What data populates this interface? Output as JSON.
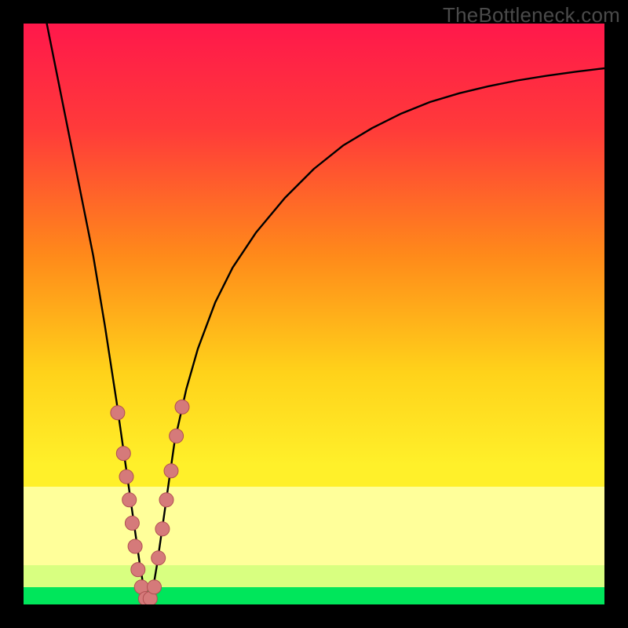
{
  "watermark": "TheBottleneck.com",
  "colors": {
    "frame": "#000000",
    "gradient_top": "#ff1a4b",
    "gradient_mid_upper": "#ff6a1f",
    "gradient_mid": "#ffe626",
    "gradient_mid_lower": "#f8ff66",
    "gradient_green": "#00e65b",
    "curve": "#000000",
    "marker_fill": "#d57a7a",
    "marker_stroke": "#b04f52",
    "pale_band": "#ffffa8"
  },
  "chart_data": {
    "type": "line",
    "title": "",
    "xlabel": "",
    "ylabel": "",
    "xlim": [
      0,
      100
    ],
    "ylim": [
      0,
      100
    ],
    "grid": false,
    "legend": false,
    "minimum_x": 21,
    "series": [
      {
        "name": "bottleneck-curve",
        "x": [
          4,
          6,
          8,
          10,
          12,
          14,
          16,
          17,
          18,
          19,
          20,
          21,
          22,
          23,
          24,
          25,
          26,
          28,
          30,
          33,
          36,
          40,
          45,
          50,
          55,
          60,
          65,
          70,
          75,
          80,
          85,
          90,
          95,
          100
        ],
        "y": [
          100,
          90,
          80,
          70,
          60,
          48,
          35,
          28,
          21,
          14,
          7,
          1,
          1,
          7,
          14,
          21,
          28,
          37,
          44,
          52,
          58,
          64,
          70,
          75,
          79,
          82,
          84.5,
          86.5,
          88,
          89.2,
          90.2,
          91,
          91.7,
          92.3
        ]
      }
    ],
    "markers": {
      "name": "highlighted-points",
      "points": [
        {
          "x": 16.2,
          "y": 33
        },
        {
          "x": 17.2,
          "y": 26
        },
        {
          "x": 17.7,
          "y": 22
        },
        {
          "x": 18.2,
          "y": 18
        },
        {
          "x": 18.7,
          "y": 14
        },
        {
          "x": 19.2,
          "y": 10
        },
        {
          "x": 19.7,
          "y": 6
        },
        {
          "x": 20.3,
          "y": 3
        },
        {
          "x": 21.0,
          "y": 1
        },
        {
          "x": 21.8,
          "y": 1
        },
        {
          "x": 22.5,
          "y": 3
        },
        {
          "x": 23.2,
          "y": 8
        },
        {
          "x": 23.9,
          "y": 13
        },
        {
          "x": 24.6,
          "y": 18
        },
        {
          "x": 25.4,
          "y": 23
        },
        {
          "x": 26.3,
          "y": 29
        },
        {
          "x": 27.3,
          "y": 34
        }
      ]
    }
  }
}
